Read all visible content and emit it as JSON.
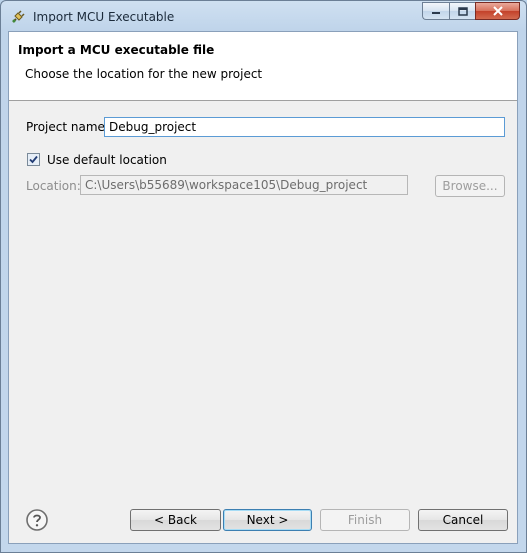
{
  "window": {
    "title": "Import MCU Executable",
    "icons": {
      "app": "plugin-plug-icon",
      "minimize": "minimize-icon",
      "maximize": "maximize-icon",
      "close": "close-icon"
    }
  },
  "header": {
    "title": "Import a MCU executable file",
    "description": "Choose the location for the new project"
  },
  "form": {
    "project_name_label": "Project name:",
    "project_name_value": "Debug_project",
    "use_default_label": "Use default location",
    "use_default_checked": true,
    "location_label": "Location:",
    "location_value": "C:\\Users\\b55689\\workspace105\\Debug_project",
    "browse_label": "Browse..."
  },
  "footer": {
    "help_icon": "help-question-icon",
    "back_label": "< Back",
    "next_label": "Next >",
    "finish_label": "Finish",
    "cancel_label": "Cancel"
  },
  "colors": {
    "accent": "#3c7fb1",
    "close_button": "#c3412a"
  }
}
